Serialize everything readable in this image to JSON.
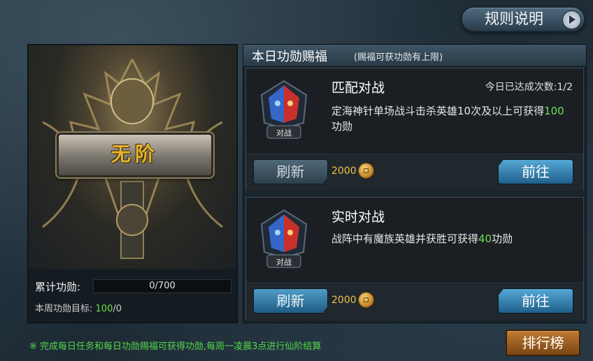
{
  "top_button": {
    "label": "规则说明",
    "icon": "play-arrow-icon"
  },
  "rank": {
    "plate_text": "无阶",
    "cumulative_label": "累计功勋:",
    "cumulative_value": "0/700",
    "cumulative_progress": 0,
    "weekly_label": "本周功勋目标:",
    "weekly_value": "100",
    "weekly_suffix": "/0"
  },
  "daily": {
    "title": "本日功勋赐福",
    "note": "(赐福可获功勋有上限)",
    "tasks": [
      {
        "title": "匹配对战",
        "count_text": "今日已达成次数:1/2",
        "desc_pre": "定海神针单场战斗击杀英雄10次及以上可获得",
        "desc_value": "100",
        "desc_post": "功勋",
        "emblem_text": "对战",
        "refresh_label": "刷新",
        "cost": "2000",
        "go_label": "前往"
      },
      {
        "title": "实时对战",
        "count_text": "",
        "desc_pre": "战阵中有魔族英雄并获胜可获得",
        "desc_value": "40",
        "desc_post": "功勋",
        "emblem_text": "对战",
        "refresh_label": "刷新",
        "cost": "2000",
        "go_label": "前往"
      }
    ]
  },
  "footer": {
    "tip": "※ 完成每日任务和每日功勋赐福可获得功勋,每周一凌晨3点进行仙阶结算",
    "rank_button": "排行榜"
  },
  "colors": {
    "accent_green": "#6fe04f",
    "coin_gold": "#f0c64a",
    "button_blue": "#3a8fc0",
    "button_orange": "#a8621f"
  }
}
